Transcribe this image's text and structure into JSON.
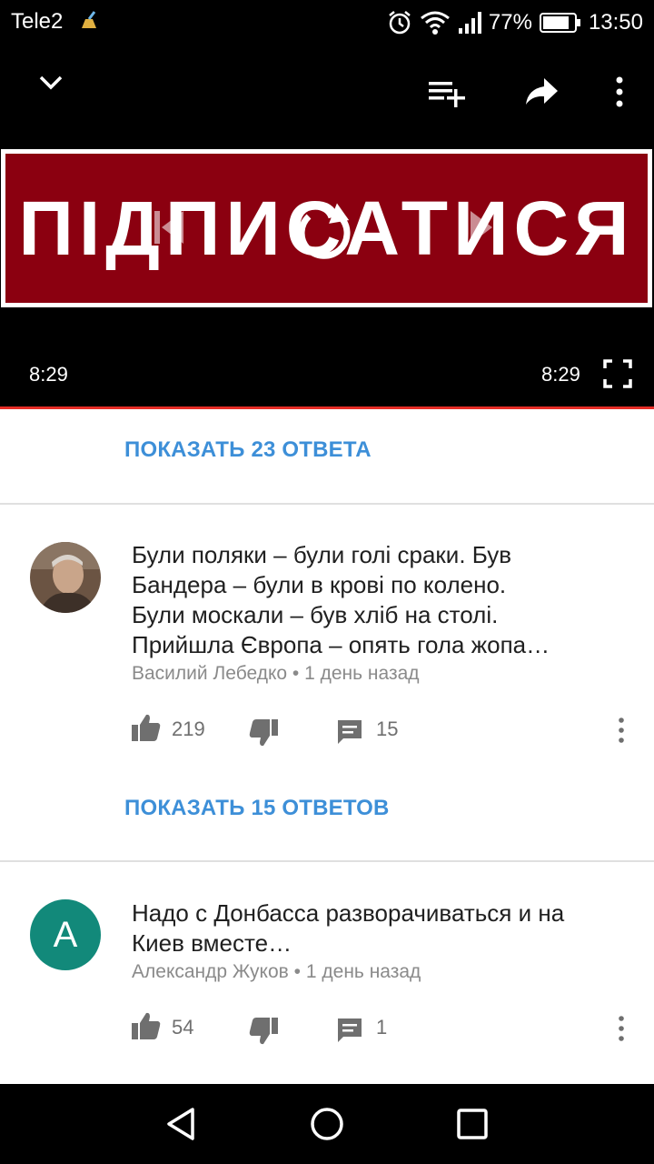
{
  "status_bar": {
    "carrier": "Tele2",
    "battery": "77%",
    "time": "13:50"
  },
  "player": {
    "video_title": "ПІДПИСАТИСЯ",
    "current_time": "8:29",
    "duration": "8:29",
    "progress": 1.0,
    "accent_color": "#e52d27"
  },
  "comments": {
    "show_replies_1": "ПОКАЗАТЬ 23 ОТВЕТА",
    "items": [
      {
        "text_lines": [
          "Були поляки – були голі сраки. Був",
          "Бандера – були в крові по колено.",
          "Були москали – був хліб на столі.",
          "Прийшла Європа – опять гола   жопа…"
        ],
        "author": "Василий Лебедко",
        "separator": "•",
        "age": "1 день назад",
        "likes": "219",
        "replies": "15",
        "show_replies": "ПОКАЗАТЬ 15 ОТВЕТОВ"
      },
      {
        "avatar_letter": "А",
        "text_lines": [
          "Надо с Донбасса разворачиваться и на",
          "Киев вместе…"
        ],
        "author": "Александр Жуков",
        "separator": "•",
        "age": "1 день назад",
        "likes": "54",
        "replies": "1"
      }
    ]
  },
  "icons": {
    "collapse": "chevron-down-icon",
    "add_to_playlist": "playlist-add-icon",
    "share": "share-icon",
    "more": "more-vert-icon",
    "replay": "replay-icon",
    "fullscreen": "fullscreen-icon",
    "like": "thumb-up-icon",
    "dislike": "thumb-down-icon",
    "reply": "comment-icon"
  },
  "colors": {
    "link": "#3d8fd8",
    "avatar_teal": "#12897a",
    "banner_red": "#8b0010"
  }
}
